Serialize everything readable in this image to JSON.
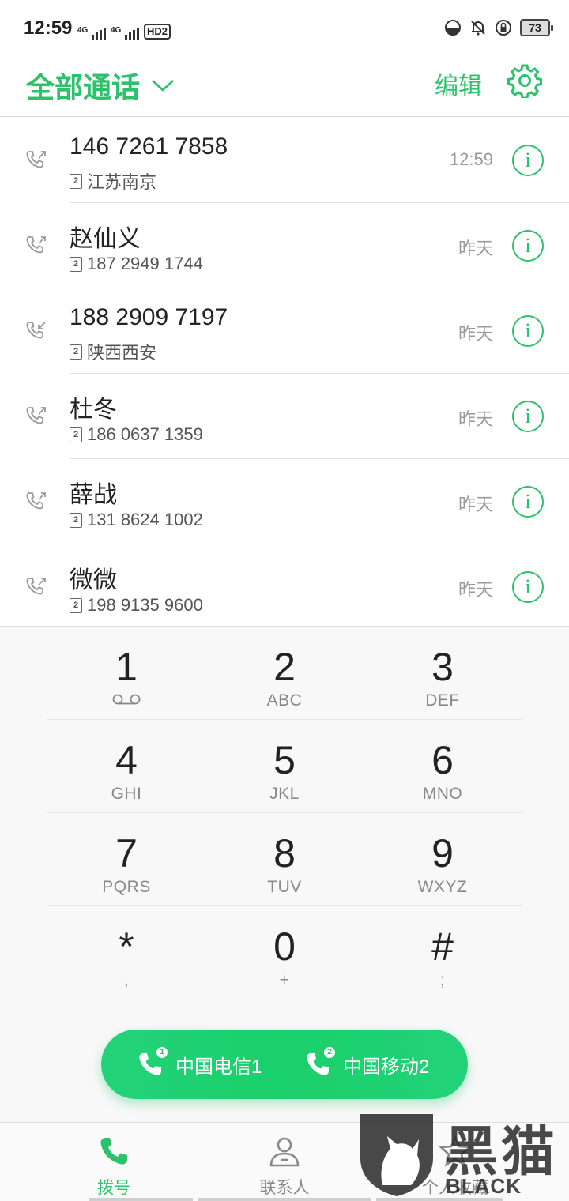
{
  "status_bar": {
    "time": "12:59",
    "sim1_network": "4G",
    "sim2_network": "4G",
    "hd_label": "HD2",
    "battery_level": "73"
  },
  "header": {
    "title": "全部通话",
    "edit_label": "编辑"
  },
  "calls": [
    {
      "name": "146 7261 7858",
      "sim": "2",
      "detail": "江苏南京",
      "time": "12:59",
      "direction": "outgoing"
    },
    {
      "name": "赵仙义",
      "sim": "2",
      "detail": "187 2949 1744",
      "time": "昨天",
      "direction": "outgoing"
    },
    {
      "name": "188 2909 7197",
      "sim": "2",
      "detail": "陕西西安",
      "time": "昨天",
      "direction": "incoming"
    },
    {
      "name": "杜冬",
      "sim": "2",
      "detail": "186 0637 1359",
      "time": "昨天",
      "direction": "outgoing"
    },
    {
      "name": "薛战",
      "sim": "2",
      "detail": "131 8624 1002",
      "time": "昨天",
      "direction": "outgoing"
    },
    {
      "name": "微微",
      "sim": "2",
      "detail": "198 9135 9600",
      "time": "昨天",
      "direction": "outgoing"
    }
  ],
  "info_glyph": "i",
  "dialpad": {
    "keys": [
      {
        "digit": "1",
        "letters": ""
      },
      {
        "digit": "2",
        "letters": "ABC"
      },
      {
        "digit": "3",
        "letters": "DEF"
      },
      {
        "digit": "4",
        "letters": "GHI"
      },
      {
        "digit": "5",
        "letters": "JKL"
      },
      {
        "digit": "6",
        "letters": "MNO"
      },
      {
        "digit": "7",
        "letters": "PQRS"
      },
      {
        "digit": "8",
        "letters": "TUV"
      },
      {
        "digit": "9",
        "letters": "WXYZ"
      },
      {
        "digit": "*",
        "letters": ","
      },
      {
        "digit": "0",
        "letters": "+"
      },
      {
        "digit": "#",
        "letters": ";"
      }
    ]
  },
  "sim_buttons": [
    {
      "label": "中国电信1",
      "sim_number": "1"
    },
    {
      "label": "中国移动2",
      "sim_number": "2"
    }
  ],
  "bottom_nav": {
    "tabs": [
      {
        "label": "拨号",
        "icon": "phone-icon"
      },
      {
        "label": "联系人",
        "icon": "person-icon"
      },
      {
        "label": "个人收藏",
        "icon": "star-icon"
      }
    ]
  },
  "watermark": {
    "cn": "黑猫",
    "en": "BLACK CAT"
  },
  "colors": {
    "accent": "#2cc26b",
    "call_button": "#1ad06a",
    "secondary_text": "#9a9a9a"
  }
}
